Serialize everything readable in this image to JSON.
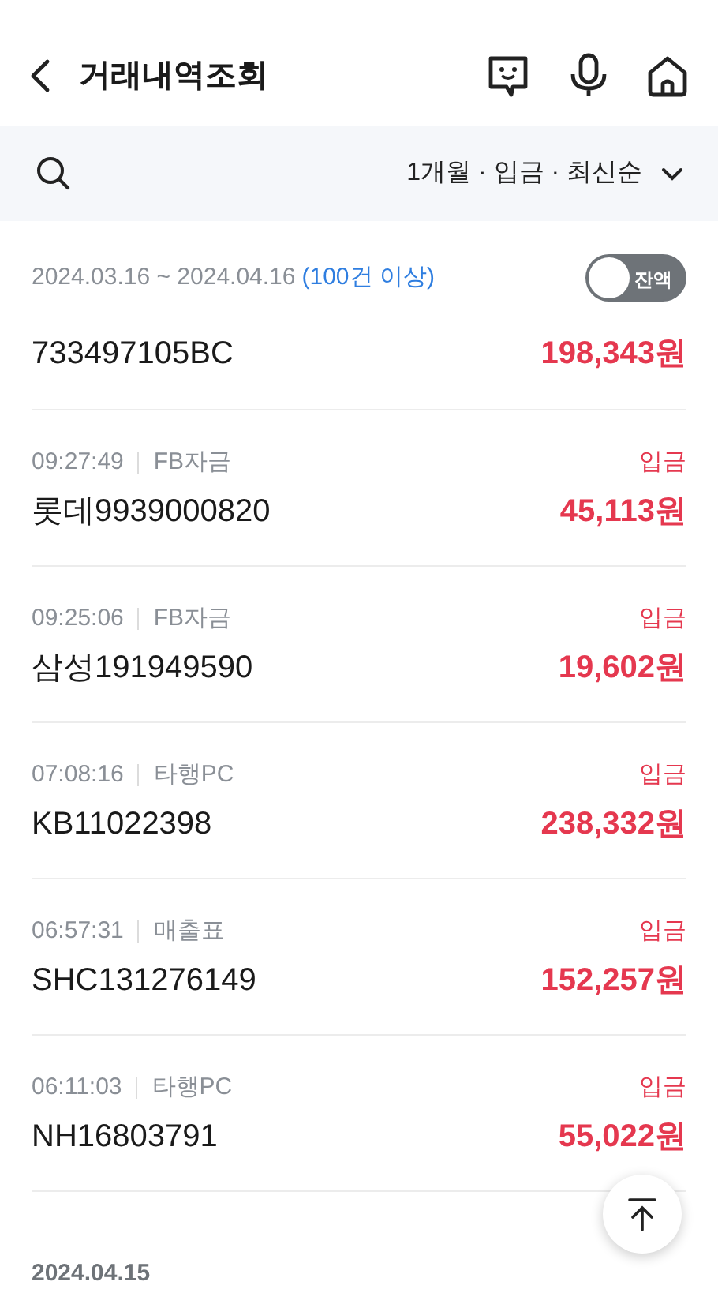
{
  "header": {
    "title": "거래내역조회"
  },
  "filter": {
    "summary": "1개월 · 입금 · 최신순"
  },
  "period": {
    "range": "2024.03.16 ~ 2024.04.16",
    "count": "(100건 이상)"
  },
  "balance_toggle": {
    "label": "잔액",
    "on": false
  },
  "transactions": [
    {
      "name": "733497105BC",
      "amount": "198,343원"
    },
    {
      "time": "09:27:49",
      "category": "FB자금",
      "type": "입금",
      "name": "롯데9939000820",
      "amount": "45,113원"
    },
    {
      "time": "09:25:06",
      "category": "FB자금",
      "type": "입금",
      "name": "삼성191949590",
      "amount": "19,602원"
    },
    {
      "time": "07:08:16",
      "category": "타행PC",
      "type": "입금",
      "name": "KB11022398",
      "amount": "238,332원"
    },
    {
      "time": "06:57:31",
      "category": "매출표",
      "type": "입금",
      "name": "SHC131276149",
      "amount": "152,257원"
    },
    {
      "time": "06:11:03",
      "category": "타행PC",
      "type": "입금",
      "name": "NH16803791",
      "amount": "55,022원"
    }
  ],
  "next_date": "2024.04.15"
}
